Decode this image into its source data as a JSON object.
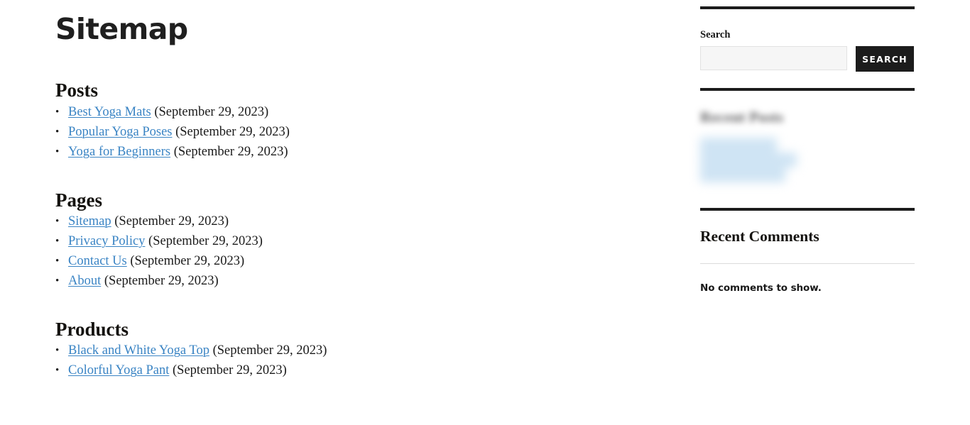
{
  "main": {
    "title": "Sitemap",
    "sections": [
      {
        "heading": "Posts",
        "items": [
          {
            "link": "Best Yoga Mats",
            "date": "(September 29, 2023)"
          },
          {
            "link": "Popular Yoga Poses",
            "date": "(September 29, 2023)"
          },
          {
            "link": "Yoga for Beginners",
            "date": "(September 29, 2023)"
          }
        ]
      },
      {
        "heading": "Pages",
        "items": [
          {
            "link": "Sitemap",
            "date": "(September 29, 2023)"
          },
          {
            "link": "Privacy Policy",
            "date": "(September 29, 2023)"
          },
          {
            "link": "Contact Us",
            "date": "(September 29, 2023)"
          },
          {
            "link": "About",
            "date": "(September 29, 2023)"
          }
        ]
      },
      {
        "heading": "Products",
        "items": [
          {
            "link": "Black and White Yoga Top",
            "date": "(September 29, 2023)"
          },
          {
            "link": "Colorful Yoga Pant",
            "date": "(September 29, 2023)"
          }
        ]
      }
    ]
  },
  "sidebar": {
    "search": {
      "label": "Search",
      "value": "",
      "placeholder": "",
      "button_label": "Search"
    },
    "recent_posts": {
      "heading": "Recent Posts",
      "blurred": true,
      "items": [
        "",
        "",
        ""
      ]
    },
    "recent_comments": {
      "heading": "Recent Comments",
      "empty_message": "No comments to show."
    }
  },
  "colors": {
    "link": "#3a84c4",
    "text": "#1a1a1a",
    "rule_thick": "#1c1c1c",
    "rule_thin": "#dcdcdc",
    "button_bg": "#1c1c1c",
    "button_text": "#ffffff",
    "input_bg": "#f6f6f6"
  }
}
